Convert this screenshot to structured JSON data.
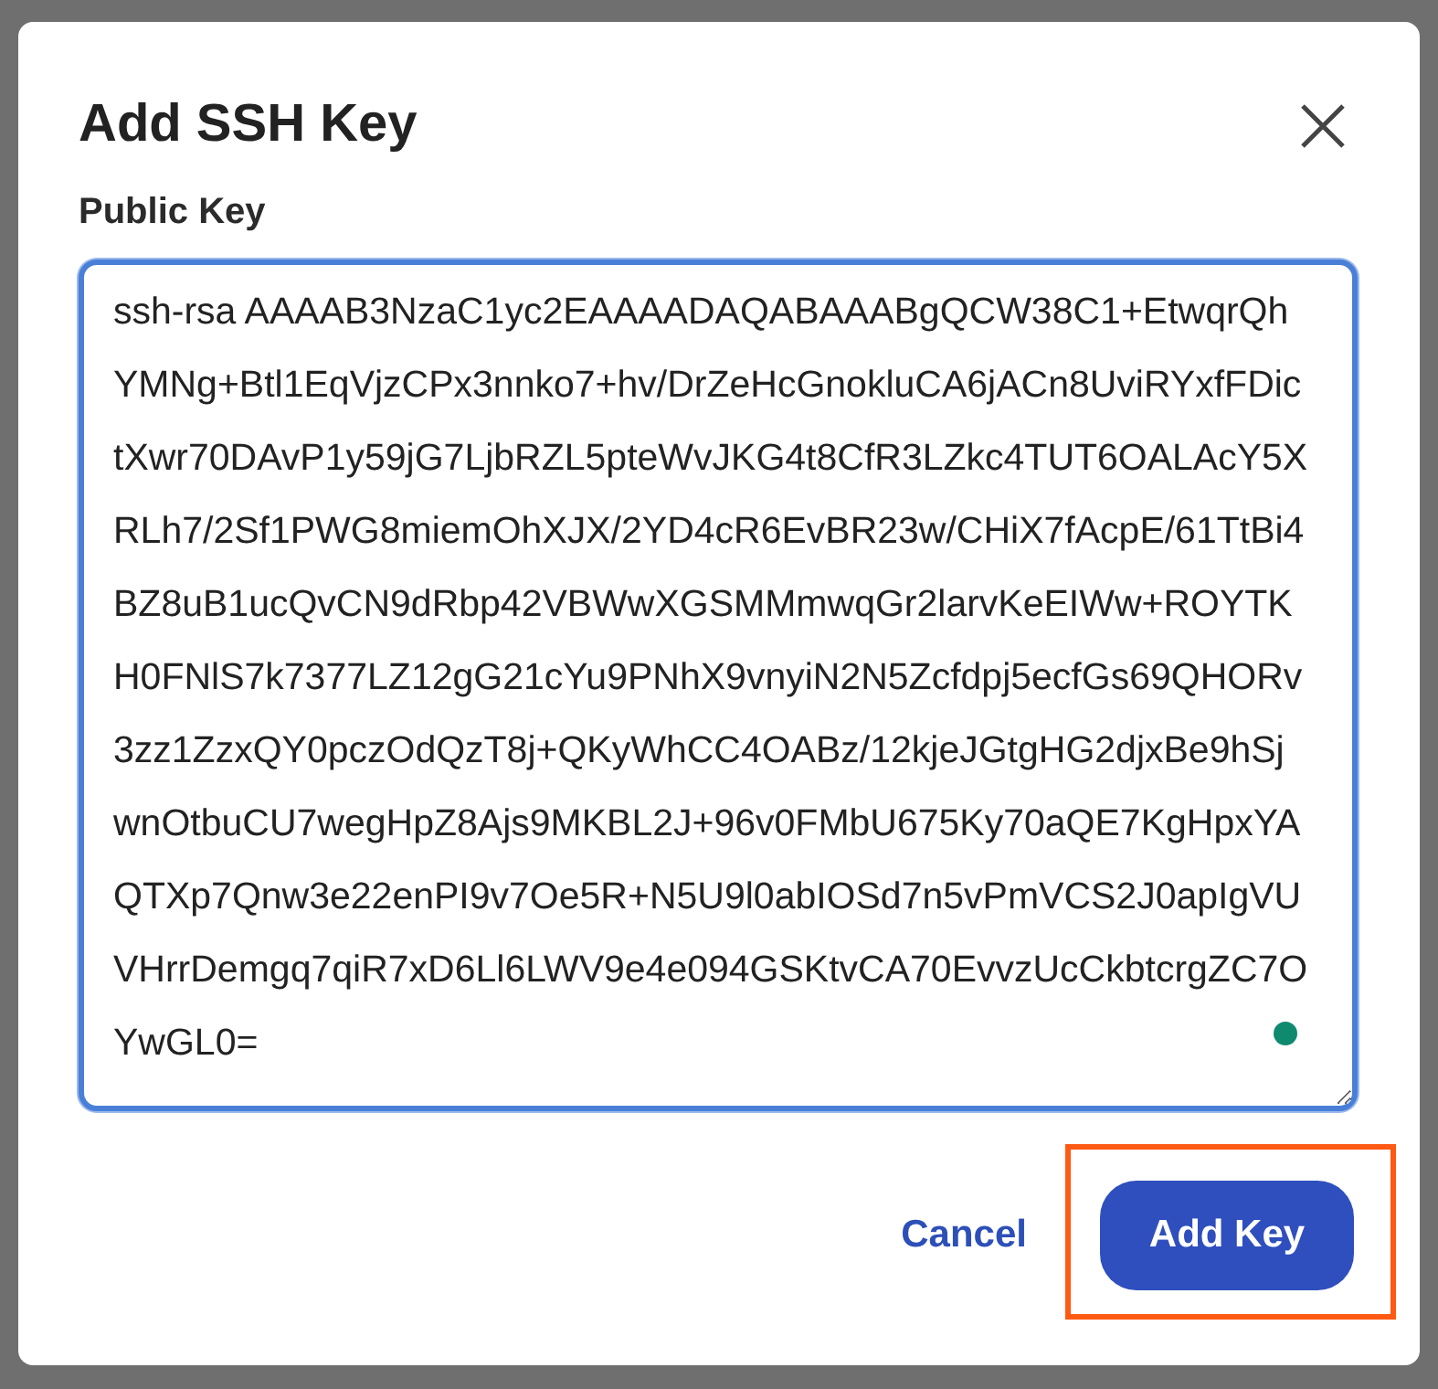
{
  "dialog": {
    "title": "Add SSH Key",
    "field_label": "Public Key",
    "key_value": "ssh-rsa AAAAB3NzaC1yc2EAAAADAQABAAABgQCW38C1+EtwqrQhYMNg+Btl1EqVjzCPx3nnko7+hv/DrZeHcGnokluCA6jACn8UviRYxfFDictXwr70DAvP1y59jG7LjbRZL5pteWvJKG4t8CfR3LZkc4TUT6OALAcY5XRLh7/2Sf1PWG8miemOhXJX/2YD4cR6EvBR23w/CHiX7fAcpE/61TtBi4BZ8uB1ucQvCN9dRbp42VBWwXGSMMmwqGr2larvKeEIWw+ROYTKH0FNlS7k7377LZ12gG21cYu9PNhX9vnyiN2N5Zcfdpj5ecfGs69QHORv3zz1ZzxQY0pczOdQzT8j+QKyWhCC4OABz/12kjeJGtgHG2djxBe9hSjwnOtbuCU7wegHpZ8Ajs9MKBL2J+96v0FMbU675Ky70aQE7KgHpxYAQTXp7Qnw3e22enPI9v7Oe5R+N5U9l0abIOSd7n5vPmVCS2J0apIgVUVHrrDemgq7qiR7xD6Ll6LWV9e4e094GSKtvCA70EvvzUcCkbtcrgZC7OYwGL0=",
    "field_focused": true,
    "buttons": [
      {
        "label": "Cancel",
        "kind": "link",
        "highlighted": false
      },
      {
        "label": "Add Key",
        "kind": "primary",
        "highlighted": true
      }
    ]
  }
}
